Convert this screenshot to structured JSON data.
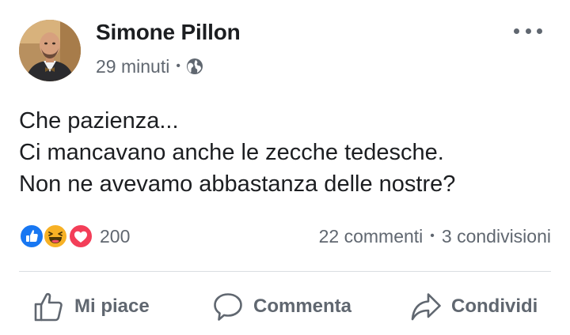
{
  "post": {
    "author": "Simone Pillon",
    "time": "29 minuti",
    "meta_separator": "•",
    "privacy_icon": "globe-icon",
    "more_icon": "more-options-icon",
    "text_lines": [
      "Che pazienza...",
      "Ci mancavano anche le zecche tedesche.",
      "Non ne avevamo abbastanza delle nostre?"
    ]
  },
  "stats": {
    "reaction_icons": [
      "like-reaction-icon",
      "haha-reaction-icon",
      "love-reaction-icon"
    ],
    "reaction_count": "200",
    "comments": "22 commenti",
    "separator": "•",
    "shares": "3 condivisioni"
  },
  "actions": {
    "like_label": "Mi piace",
    "comment_label": "Commenta",
    "share_label": "Condividi"
  },
  "colors": {
    "text_primary": "#1c1e21",
    "text_secondary": "#606770",
    "like_blue": "#1877f2",
    "love_red": "#f33e58",
    "haha_yellow": "#f7b125",
    "divider": "#dadde1"
  }
}
